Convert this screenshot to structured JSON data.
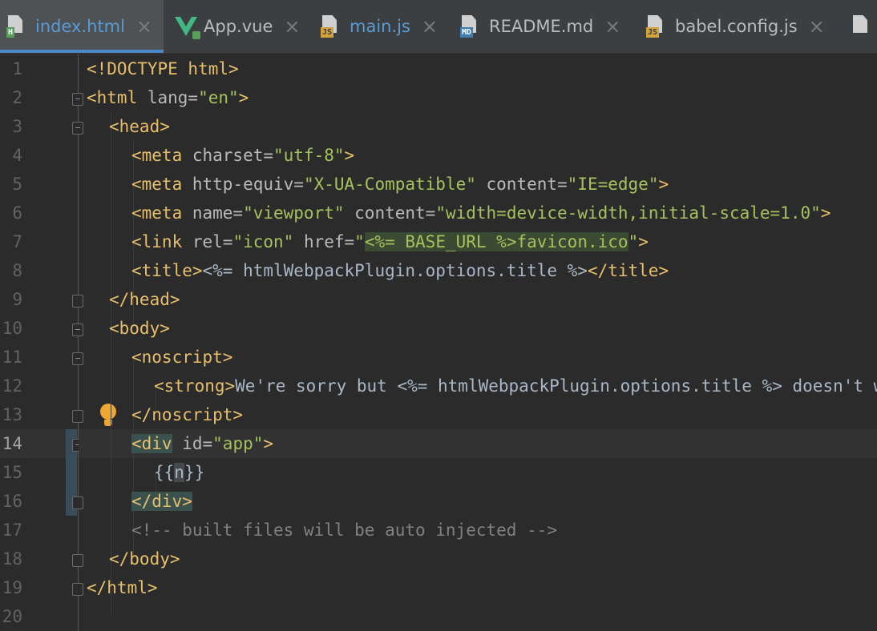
{
  "tabs": [
    {
      "label": "index.html",
      "icon": "html-file-icon",
      "active": true
    },
    {
      "label": "App.vue",
      "icon": "vue-file-icon",
      "active": false
    },
    {
      "label": "main.js",
      "icon": "js-file-icon",
      "active": false
    },
    {
      "label": "README.md",
      "icon": "markdown-file-icon",
      "active": false
    },
    {
      "label": "babel.config.js",
      "icon": "js-file-icon",
      "active": false
    }
  ],
  "badges": {
    "html": "H",
    "js": "JS",
    "md": "MD"
  },
  "close_glyph": "×",
  "current_line": 14,
  "line_numbers": [
    "1",
    "2",
    "3",
    "4",
    "5",
    "6",
    "7",
    "8",
    "9",
    "10",
    "11",
    "12",
    "13",
    "14",
    "15",
    "16",
    "17",
    "18",
    "19",
    "20"
  ],
  "code": {
    "l1": {
      "a": "<!DOCTYPE html>"
    },
    "l2": {
      "a": "<html ",
      "b": "lang=",
      "c": "\"en\"",
      "d": ">"
    },
    "l3": {
      "a": "<head>"
    },
    "l4": {
      "a": "<meta ",
      "b": "charset=",
      "c": "\"utf-8\"",
      "d": ">"
    },
    "l5": {
      "a": "<meta ",
      "b": "http-equiv=",
      "c": "\"X-UA-Compatible\"",
      "d": " content=",
      "e": "\"IE=edge\"",
      "f": ">"
    },
    "l6": {
      "a": "<meta ",
      "b": "name=",
      "c": "\"viewport\"",
      "d": " content=",
      "e": "\"width=device-width,initial-scale=1.0\"",
      "f": ">"
    },
    "l7": {
      "a": "<link ",
      "b": "rel=",
      "c": "\"icon\"",
      "d": " href=",
      "e": "\"",
      "f": "<%= BASE_URL %>favicon.ico",
      "g": "\"",
      "h": ">"
    },
    "l8": {
      "a": "<title>",
      "b": "<%= htmlWebpackPlugin.options.title %>",
      "c": "</title>"
    },
    "l9": {
      "a": "</head>"
    },
    "l10": {
      "a": "<body>"
    },
    "l11": {
      "a": "<noscript>"
    },
    "l12": {
      "a": "<strong>",
      "b": "We're sorry but <%= htmlWebpackPlugin.options.title %> doesn't work properly without JavaScript enabled."
    },
    "l13": {
      "a": "</noscript>"
    },
    "l14": {
      "a": "<div",
      "b": " id=",
      "c": "\"app\"",
      "d": ">"
    },
    "l15": {
      "a": "{{",
      "b": "n",
      "c": "}}"
    },
    "l16": {
      "a": "</div>"
    },
    "l17": {
      "a": "<!-- built files will be auto injected -->"
    },
    "l18": {
      "a": "</body>"
    },
    "l19": {
      "a": "</html>"
    }
  }
}
